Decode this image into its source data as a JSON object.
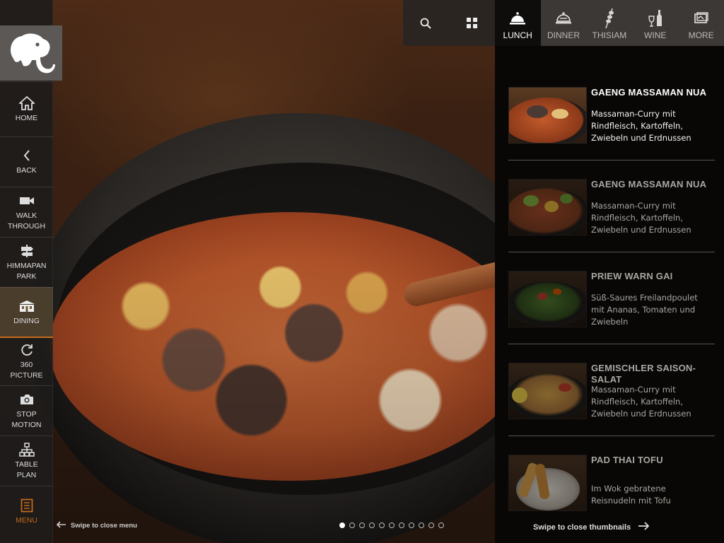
{
  "colors": {
    "accent": "#c26a1c",
    "active_tab": "#0f0d0c",
    "sidebar_active": "#6e5a3c"
  },
  "sidebar": {
    "logo_icon": "elephant-icon",
    "items": [
      {
        "label": "HOME",
        "icon": "home-icon"
      },
      {
        "label": "BACK",
        "icon": "chevron-left-icon"
      },
      {
        "label": "WALK\nTHROUGH",
        "icon": "video-camera-icon"
      },
      {
        "label": "HIMMAPAN\nPARK",
        "icon": "signpost-icon"
      },
      {
        "label": "DINING",
        "icon": "building-icon",
        "active": true
      },
      {
        "label": "360\nPICTURE",
        "icon": "rotate-icon"
      },
      {
        "label": "STOP\nMOTION",
        "icon": "camera-icon"
      },
      {
        "label": "TABLE\nPLAN",
        "icon": "sitemap-icon"
      },
      {
        "label": "MENU",
        "icon": "menu-book-icon"
      }
    ]
  },
  "topbar": {
    "search_icon": "search-icon",
    "grid_icon": "grid-icon",
    "tabs": [
      {
        "label": "LUNCH",
        "icon": "cloche-icon",
        "active": true
      },
      {
        "label": "DINNER",
        "icon": "covered-dish-icon"
      },
      {
        "label": "THISIAM",
        "icon": "skewer-icon"
      },
      {
        "label": "WINE",
        "icon": "wine-icon"
      },
      {
        "label": "MORE",
        "icon": "more-icon"
      }
    ]
  },
  "dishes": [
    {
      "name": "GAENG MASSAMAN NUA",
      "description": "Massaman-Curry mit Rindfleisch, Kartoffeln, Zwiebeln und Erdnussen"
    },
    {
      "name": "GAENG MASSAMAN NUA",
      "description": "Massaman-Curry mit Rindfleisch, Kartoffeln, Zwiebeln und Erdnussen"
    },
    {
      "name": "PRIEW WARN GAI",
      "description": "Süß-Saures Freilandpoulet mit Ananas, Tomaten und Zwiebeln"
    },
    {
      "name": "GEMISCHLER SAISON-SALAT",
      "description": "Massaman-Curry mit Rindfleisch, Kartoffeln, Zwiebeln und Erdnussen"
    },
    {
      "name": "PAD THAI TOFU",
      "description": "Im Wok gebratene Reisnudeln mit Tofu"
    }
  ],
  "footer": {
    "close_menu_hint": "Swipe to close menu",
    "close_thumbnails_hint": "Swipe to close thumbnails",
    "pager": {
      "total": 11,
      "current": 1
    }
  }
}
